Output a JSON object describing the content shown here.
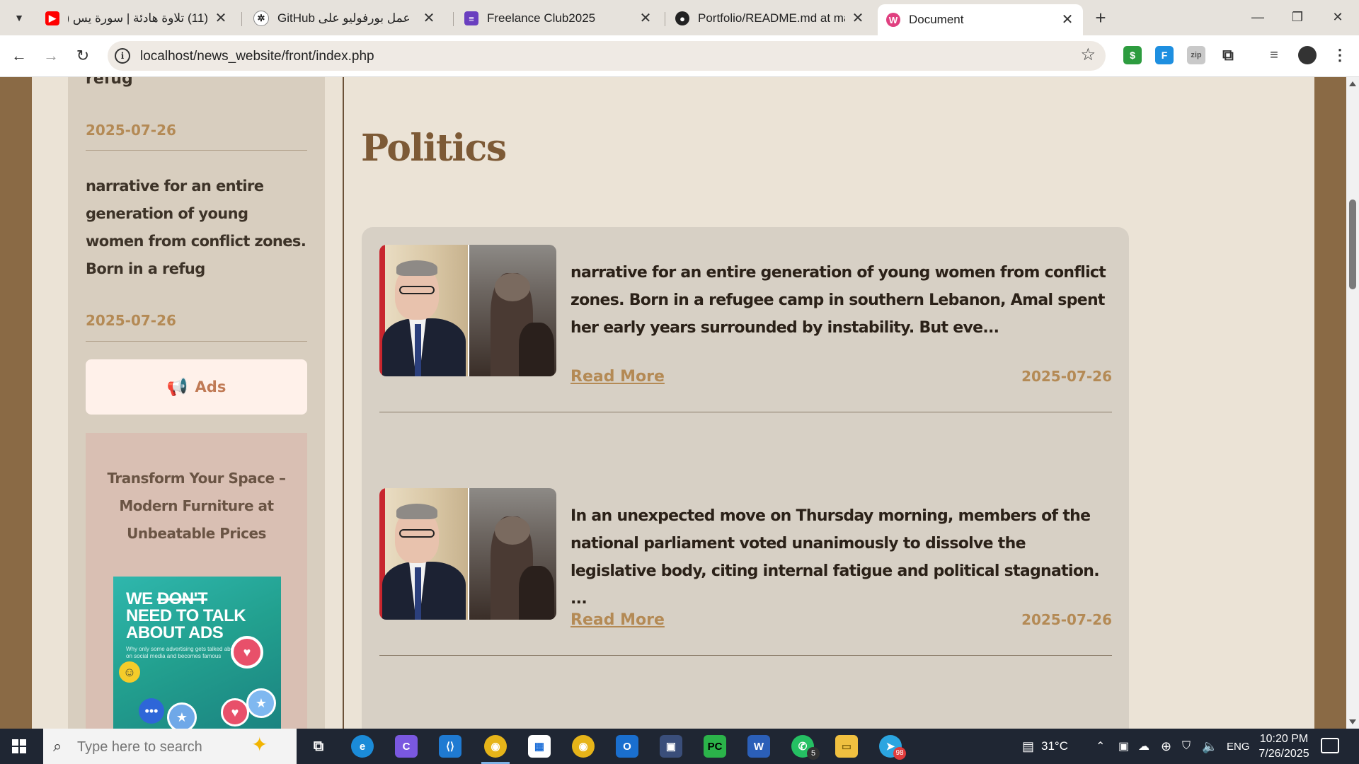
{
  "browser": {
    "tabs": [
      {
        "title": "(11) تلاوة هادئة | سورة يس ( القار",
        "favicon": "youtube-icon",
        "color": "#ff0000"
      },
      {
        "title": "عمل بورفوليو على GitHub",
        "favicon": "chatgpt-icon",
        "color": "#222222"
      },
      {
        "title": "Freelance Club2025",
        "favicon": "forms-icon",
        "color": "#6a3fbf"
      },
      {
        "title": "Portfolio/README.md at main ·",
        "favicon": "github-icon",
        "color": "#222222"
      },
      {
        "title": "Document",
        "favicon": "document-icon",
        "color": "#e04080"
      }
    ],
    "url": "localhost/news_website/front/index.php"
  },
  "sidebar": {
    "cut_text": "refug",
    "date_1": "2025-07-26",
    "item_text": "narrative for an entire generation of young women from conflict zones. Born in a refug",
    "date_2": "2025-07-26",
    "ads_label": "Ads",
    "promo_title": "Transform Your Space – Modern Furniture at Unbeatable Prices",
    "promo_image": {
      "line1": "WE",
      "line1_struck": "DON'T",
      "line2": "NEED TO TALK",
      "line3": "ABOUT ADS",
      "caption": "Why only some advertising gets talked about on social media and becomes famous"
    }
  },
  "main": {
    "section_title": "Politics",
    "articles": [
      {
        "text": "narrative for an entire generation of young women from conflict zones. Born in a refugee camp in southern Lebanon, Amal spent her early years surrounded by instability. But eve...",
        "read_more": "Read More",
        "date": "2025-07-26"
      },
      {
        "text": "In an unexpected move on Thursday morning, members of the national parliament voted unanimously to dissolve the legislative body, citing internal fatigue and political stagnation. ...",
        "read_more": "Read More",
        "date": "2025-07-26"
      }
    ]
  },
  "taskbar": {
    "search_placeholder": "Type here to search",
    "temperature": "31°C",
    "language": "ENG",
    "time": "10:20 PM",
    "date": "7/26/2025",
    "whatsapp_badge": "5",
    "telegram_badge": "98"
  }
}
